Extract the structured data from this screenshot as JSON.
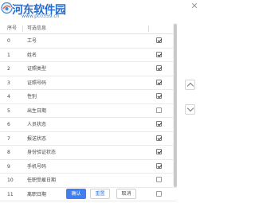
{
  "watermark": {
    "title": "河东软件园",
    "url": "www.pc0359.cn"
  },
  "header": {
    "col_index": "序号",
    "col_name": "可选信息"
  },
  "rows": [
    {
      "index": "0",
      "label": "工号",
      "checked": true
    },
    {
      "index": "1",
      "label": "姓名",
      "checked": true
    },
    {
      "index": "2",
      "label": "证照类型",
      "checked": true
    },
    {
      "index": "3",
      "label": "证照号码",
      "checked": true
    },
    {
      "index": "4",
      "label": "性别",
      "checked": true
    },
    {
      "index": "5",
      "label": "出生日期",
      "checked": false
    },
    {
      "index": "6",
      "label": "人员状态",
      "checked": true
    },
    {
      "index": "7",
      "label": "报送状态",
      "checked": true
    },
    {
      "index": "8",
      "label": "身份验证状态",
      "checked": true
    },
    {
      "index": "9",
      "label": "手机号码",
      "checked": true
    },
    {
      "index": "10",
      "label": "任职受雇日期",
      "checked": false
    },
    {
      "index": "11",
      "label": "离职日期",
      "checked": false
    }
  ],
  "buttons": {
    "confirm": "确认",
    "reset": "重置",
    "cancel": "取消"
  },
  "icons": {
    "close": "close-icon",
    "up": "arrow-up-icon",
    "down": "arrow-down-icon"
  },
  "colors": {
    "primary": "#3f7ff0"
  }
}
